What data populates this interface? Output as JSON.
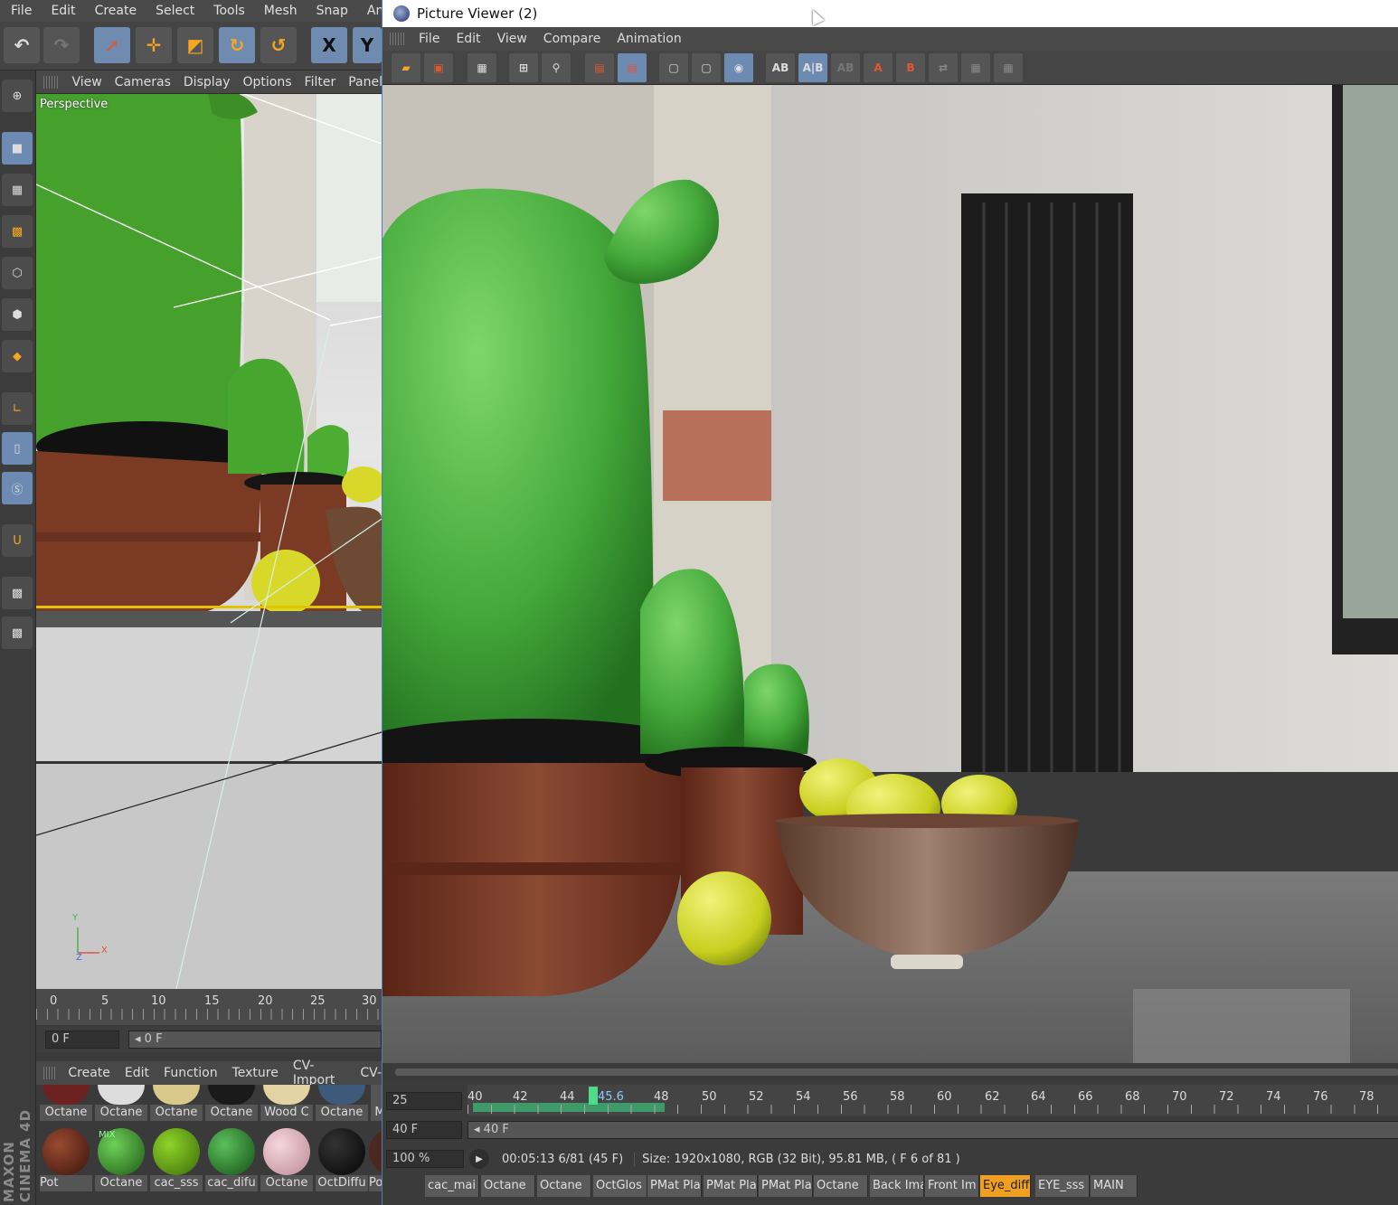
{
  "main_menu": [
    "File",
    "Edit",
    "Create",
    "Select",
    "Tools",
    "Mesh",
    "Snap",
    "Animate"
  ],
  "toolbar": {
    "axis_x": "X",
    "axis_y": "Y"
  },
  "viewport": {
    "menu": [
      "View",
      "Cameras",
      "Display",
      "Options",
      "Filter",
      "Panel"
    ],
    "label": "Perspective",
    "axis_y": "Y",
    "axis_x": "X",
    "axis_z": "Z"
  },
  "c4d_timeline": {
    "ticks": [
      "0",
      "5",
      "10",
      "15",
      "20",
      "25",
      "30"
    ],
    "current_frame": "0 F",
    "slider_frame": "0 F"
  },
  "material_manager": {
    "menu": [
      "Create",
      "Edit",
      "Function",
      "Texture",
      "CV-Import",
      "CV-"
    ],
    "row1": [
      "Octane",
      "Octane",
      "Octane",
      "Octane",
      "Wood C",
      "Octane",
      "M"
    ],
    "row2": [
      "Pot",
      "Octane",
      "cac_sss",
      "cac_difu",
      "Octane",
      "OctDiffu",
      "Pot"
    ],
    "mix_badge": "MIX"
  },
  "brand": "MAXON CINEMA 4D",
  "picture_viewer": {
    "title": "Picture Viewer (2)",
    "menu": [
      "File",
      "Edit",
      "View",
      "Compare",
      "Animation"
    ],
    "timeline_ticks": [
      "40",
      "42",
      "44",
      "45.6",
      "48",
      "50",
      "52",
      "54",
      "56",
      "58",
      "60",
      "62",
      "64",
      "66",
      "68",
      "70",
      "72",
      "74",
      "76",
      "78"
    ],
    "fps_value": "25",
    "frame_value": "40 F",
    "frame_slider": "40 F",
    "zoom": "100 %",
    "time": "00:05:13 6/81 (45 F)",
    "size_info": "Size: 1920x1080, RGB (32 Bit), 95.81 MB,  ( F 6 of 81 )"
  },
  "material_tabs": [
    "cac_mai",
    "Octane",
    "Octane",
    "OctGlos",
    "PMat Pla",
    "PMat Pla",
    "PMat Pla",
    "Octane",
    "Back Ima",
    "Front Im",
    "Eye_diff",
    "EYE_sss",
    "MAIN"
  ],
  "active_tab": "Eye_diff",
  "colors": {
    "accent": "#6d8ab2",
    "highlight": "#f0a020",
    "cactus": "#4caa3c",
    "pot": "#7a3a24"
  }
}
